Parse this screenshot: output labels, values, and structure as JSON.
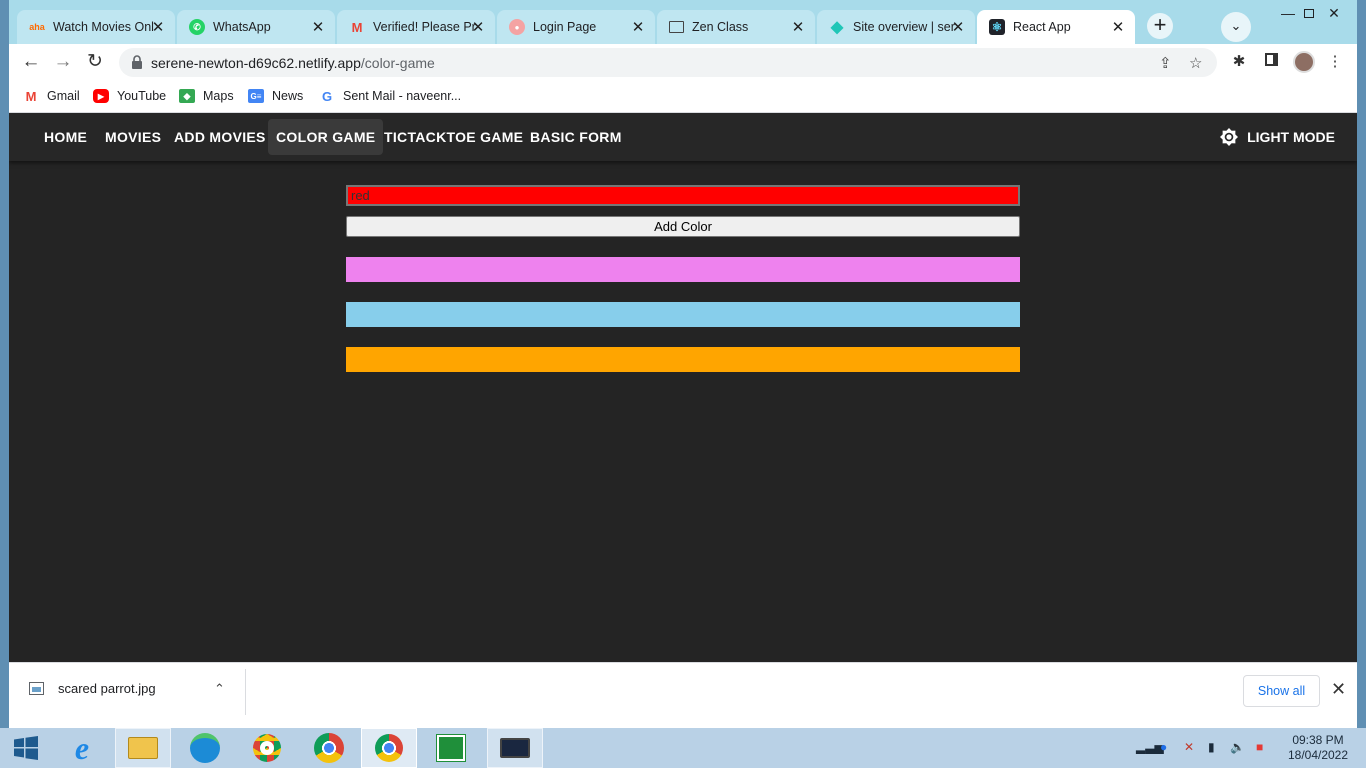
{
  "browser": {
    "tabs": [
      {
        "title": "Watch Movies Onl",
        "icon": "aha-icon",
        "color": "#ff6a00"
      },
      {
        "title": "WhatsApp",
        "icon": "whatsapp-icon",
        "color": "#25d366"
      },
      {
        "title": "Verified! Please Pr",
        "icon": "gmail-icon",
        "color": "#ea4335"
      },
      {
        "title": "Login Page",
        "icon": "login-icon",
        "color": "#f4a3a3"
      },
      {
        "title": "Zen Class",
        "icon": "zen-icon",
        "color": "#444444"
      },
      {
        "title": "Site overview | ser",
        "icon": "netlify-icon",
        "color": "#20c6b7"
      },
      {
        "title": "React App",
        "icon": "react-icon",
        "color": "#61dafb"
      }
    ],
    "url": {
      "domain": "serene-newton-d69c62.netlify.app",
      "path": "/color-game"
    },
    "bookmarks": [
      {
        "label": "Gmail",
        "icon": "gmail-icon"
      },
      {
        "label": "YouTube",
        "icon": "youtube-icon"
      },
      {
        "label": "Maps",
        "icon": "maps-icon"
      },
      {
        "label": "News",
        "icon": "news-icon"
      },
      {
        "label": "Sent Mail - naveenr...",
        "icon": "google-icon"
      }
    ]
  },
  "app": {
    "nav": [
      "HOME",
      "MOVIES",
      "ADD MOVIES",
      "COLOR GAME",
      "TICTACKTOE GAME",
      "BASIC FORM"
    ],
    "active_nav": "COLOR GAME",
    "mode_toggle": "LIGHT MODE",
    "color_input": {
      "value": "red"
    },
    "add_button": "Add Color",
    "input_bg": "#ff0000",
    "colors": [
      "#ee82ee",
      "#87ceeb",
      "#ffa500"
    ]
  },
  "downloads": {
    "file": "scared parrot.jpg",
    "show_all": "Show all"
  },
  "taskbar": {
    "time": "09:38 PM",
    "date": "18/04/2022"
  }
}
